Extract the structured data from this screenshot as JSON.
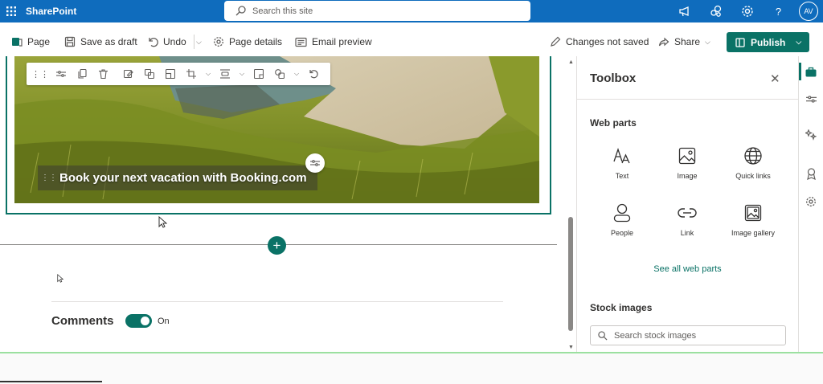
{
  "suite": {
    "app_name": "SharePoint",
    "search_placeholder": "Search this site",
    "avatar_initials": "AV",
    "help_label": "?",
    "brand_color": "#0f6cbd"
  },
  "command_bar": {
    "page_label": "Page",
    "save_draft_label": "Save as draft",
    "undo_label": "Undo",
    "page_details_label": "Page details",
    "email_preview_label": "Email preview",
    "changes_status": "Changes not saved",
    "share_label": "Share",
    "publish_label": "Publish",
    "accent_color": "#0a7266"
  },
  "canvas": {
    "hero_title": "Book your next vacation with Booking.com",
    "comments_label": "Comments",
    "comments_toggle_state": "On",
    "comments_enabled": true
  },
  "toolbox": {
    "title": "Toolbox",
    "web_parts_heading": "Web parts",
    "web_parts": [
      {
        "label": "Text",
        "icon": "text-icon"
      },
      {
        "label": "Image",
        "icon": "image-icon"
      },
      {
        "label": "Quick links",
        "icon": "globe-icon"
      },
      {
        "label": "People",
        "icon": "person-icon"
      },
      {
        "label": "Link",
        "icon": "link-icon"
      },
      {
        "label": "Image gallery",
        "icon": "image-gallery-icon"
      }
    ],
    "see_all_label": "See all web parts",
    "stock_images_heading": "Stock images",
    "stock_search_placeholder": "Search stock images"
  }
}
